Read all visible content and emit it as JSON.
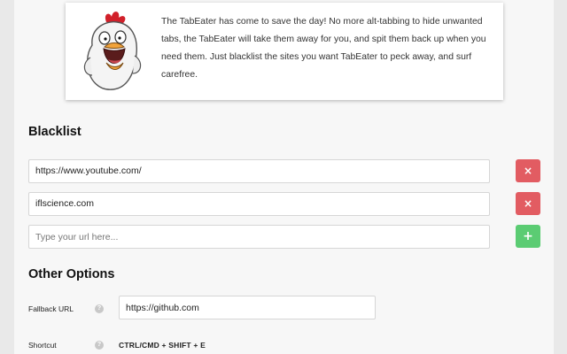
{
  "hero": {
    "mascot_icon": "screaming-chicken-mascot",
    "text": "The TabEater has come to save the day! No more alt-tabbing to hide unwanted tabs, the TabEater will take them away for you, and spit them back up when you need them. Just blacklist the sites you want TabEater to peck away, and surf carefree."
  },
  "blacklist": {
    "title": "Blacklist",
    "entries": [
      {
        "url": "https://www.youtube.com/",
        "remove_label": "×"
      },
      {
        "url": "iflscience.com",
        "remove_label": "×"
      }
    ],
    "new_entry": {
      "placeholder": "Type your url here...",
      "add_label": "+"
    }
  },
  "other_options": {
    "title": "Other Options",
    "fallback": {
      "label": "Fallback URL",
      "help": "?",
      "value": "https://github.com"
    },
    "shortcut": {
      "label": "Shortcut",
      "help": "?",
      "value": "CTRL/CMD + SHIFT + E"
    }
  },
  "colors": {
    "remove_button": "#e25c62",
    "add_button": "#5bcc73"
  }
}
